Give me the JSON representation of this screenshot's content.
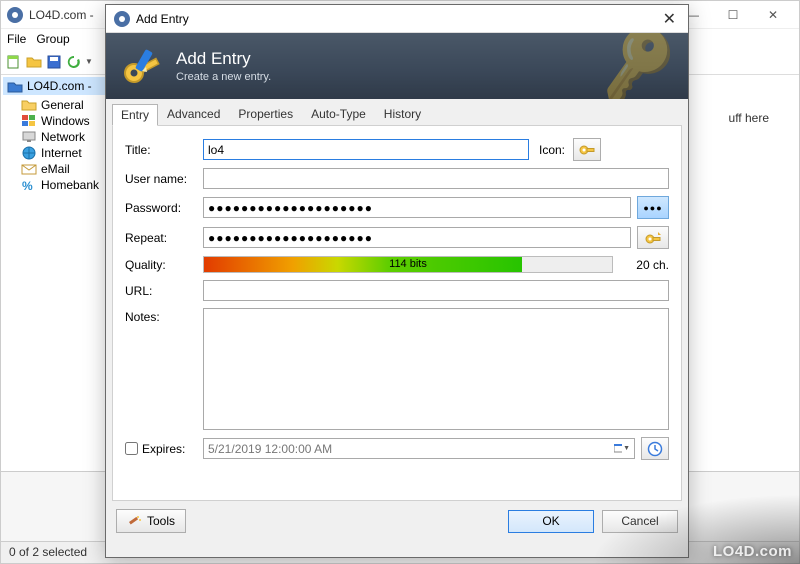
{
  "main": {
    "title": "LO4D.com -",
    "menu": {
      "file": "File",
      "group": "Group"
    },
    "tree": {
      "root": "LO4D.com -",
      "items": [
        "General",
        "Windows",
        "Network",
        "Internet",
        "eMail",
        "Homebank"
      ]
    },
    "right_hint": "uff here",
    "status": "0 of 2 selected",
    "win": {
      "min": "—",
      "max": "☐",
      "close": "✕"
    }
  },
  "dialog": {
    "title": "Add Entry",
    "header_title": "Add Entry",
    "header_sub": "Create a new entry.",
    "close_glyph": "✕",
    "tabs": [
      "Entry",
      "Advanced",
      "Properties",
      "Auto-Type",
      "History"
    ],
    "labels": {
      "title": "Title:",
      "icon": "Icon:",
      "username": "User name:",
      "password": "Password:",
      "repeat": "Repeat:",
      "quality": "Quality:",
      "url": "URL:",
      "notes": "Notes:",
      "expires": "Expires:"
    },
    "values": {
      "title": "lo4",
      "username": "",
      "password_mask": "●●●●●●●●●●●●●●●●●●●●",
      "repeat_mask": "●●●●●●●●●●●●●●●●●●●●",
      "quality_bits": "114 bits",
      "quality_chars": "20 ch.",
      "url": "",
      "notes": "",
      "expires_dt": "5/21/2019 12:00:00 AM"
    },
    "buttons": {
      "tools": "Tools",
      "ok": "OK",
      "cancel": "Cancel",
      "reveal": "●●●"
    }
  },
  "watermark": "LO4D.com"
}
